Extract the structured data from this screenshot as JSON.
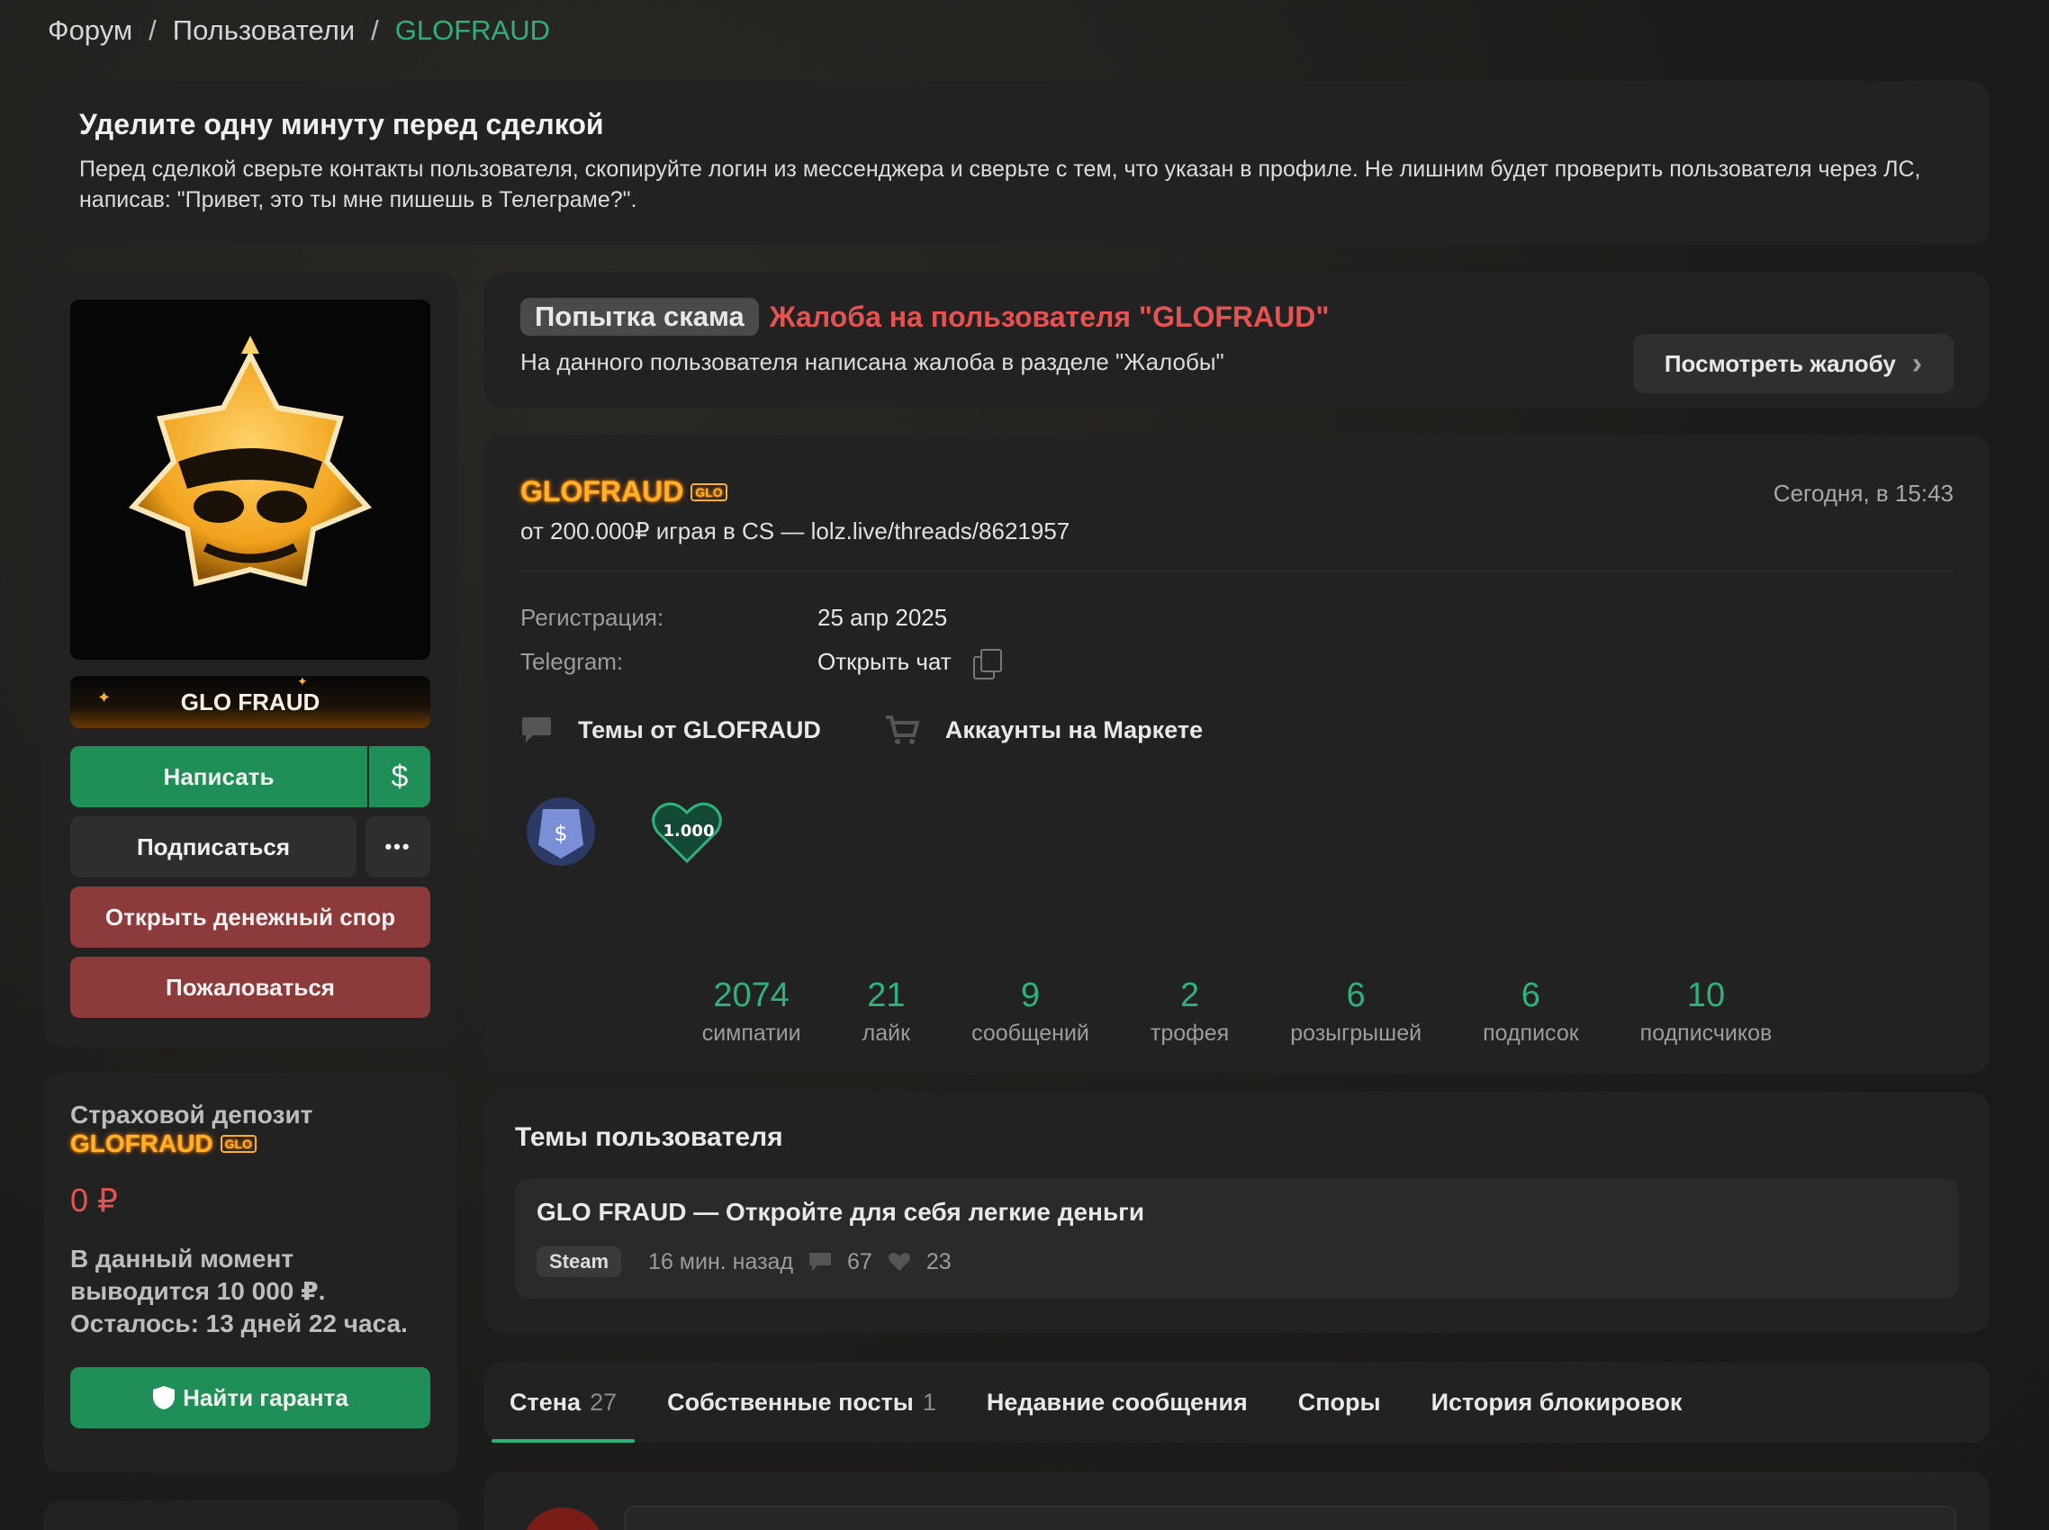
{
  "breadcrumb": {
    "forum": "Форум",
    "users": "Пользователи",
    "current": "GLOFRAUD",
    "sep": "/"
  },
  "notice": {
    "title": "Уделите одну минуту перед сделкой",
    "text": "Перед сделкой сверьте контакты пользователя, скопируйте логин из мессенджера и сверьте с тем, что указан в профиле. Не лишним будет проверить пользователя через ЛС, написав: \"Привет, это ты мне пишешь в Телеграме?\"."
  },
  "left": {
    "banner": "GLO FRAUD",
    "write": "Написать",
    "dollar": "$",
    "subscribe": "Подписаться",
    "more": "•••",
    "dispute": "Открыть денежный спор",
    "report": "Пожаловаться"
  },
  "deposit": {
    "title": "Страховой депозит",
    "name": "GLOFRAUD",
    "tag": "GLO",
    "amount": "0 ₽",
    "note": "В данный момент выводится 10 000 ₽. Осталось: 13 дней 22 часа.",
    "find_guarantor": "Найти гаранта"
  },
  "complaint": {
    "badge": "Попытка скама",
    "title": "Жалоба на пользователя \"GLOFRAUD\"",
    "desc": "На данного пользователя написана жалоба в разделе \"Жалобы\"",
    "view": "Посмотреть жалобу",
    "chevron": "›"
  },
  "profile": {
    "name": "GLOFRAUD",
    "tag": "GLO",
    "status": "от 200.000₽ играя в CS — lolz.live/threads/8621957",
    "date": "Сегодня, в 15:43",
    "reg_label": "Регистрация:",
    "reg_value": "25 апр 2025",
    "tg_label": "Telegram:",
    "tg_value": "Открыть чат",
    "topics_link": "Темы от GLOFRAUD",
    "market_link": "Аккаунты на Маркете",
    "badge2_text": "1.000",
    "stats": [
      {
        "n": "2074",
        "l": "симпатии"
      },
      {
        "n": "21",
        "l": "лайк"
      },
      {
        "n": "9",
        "l": "сообщений"
      },
      {
        "n": "2",
        "l": "трофея"
      },
      {
        "n": "6",
        "l": "розыгрышей"
      },
      {
        "n": "6",
        "l": "подписок"
      },
      {
        "n": "10",
        "l": "подписчиков"
      }
    ]
  },
  "topics": {
    "title": "Темы пользователя",
    "item": {
      "title": "GLO FRAUD — Откройте для себя легкие деньги",
      "tag": "Steam",
      "time": "16 мин. назад",
      "comments": "67",
      "likes": "23"
    }
  },
  "tabs": [
    {
      "label": "Стена",
      "count": "27"
    },
    {
      "label": "Собственные посты",
      "count": "1"
    },
    {
      "label": "Недавние сообщения",
      "count": ""
    },
    {
      "label": "Споры",
      "count": ""
    },
    {
      "label": "История блокировок",
      "count": ""
    }
  ],
  "colors": {
    "accent": "#2fb27a",
    "danger": "#e55252",
    "gold": "#ffb12a",
    "panel": "#222222"
  }
}
